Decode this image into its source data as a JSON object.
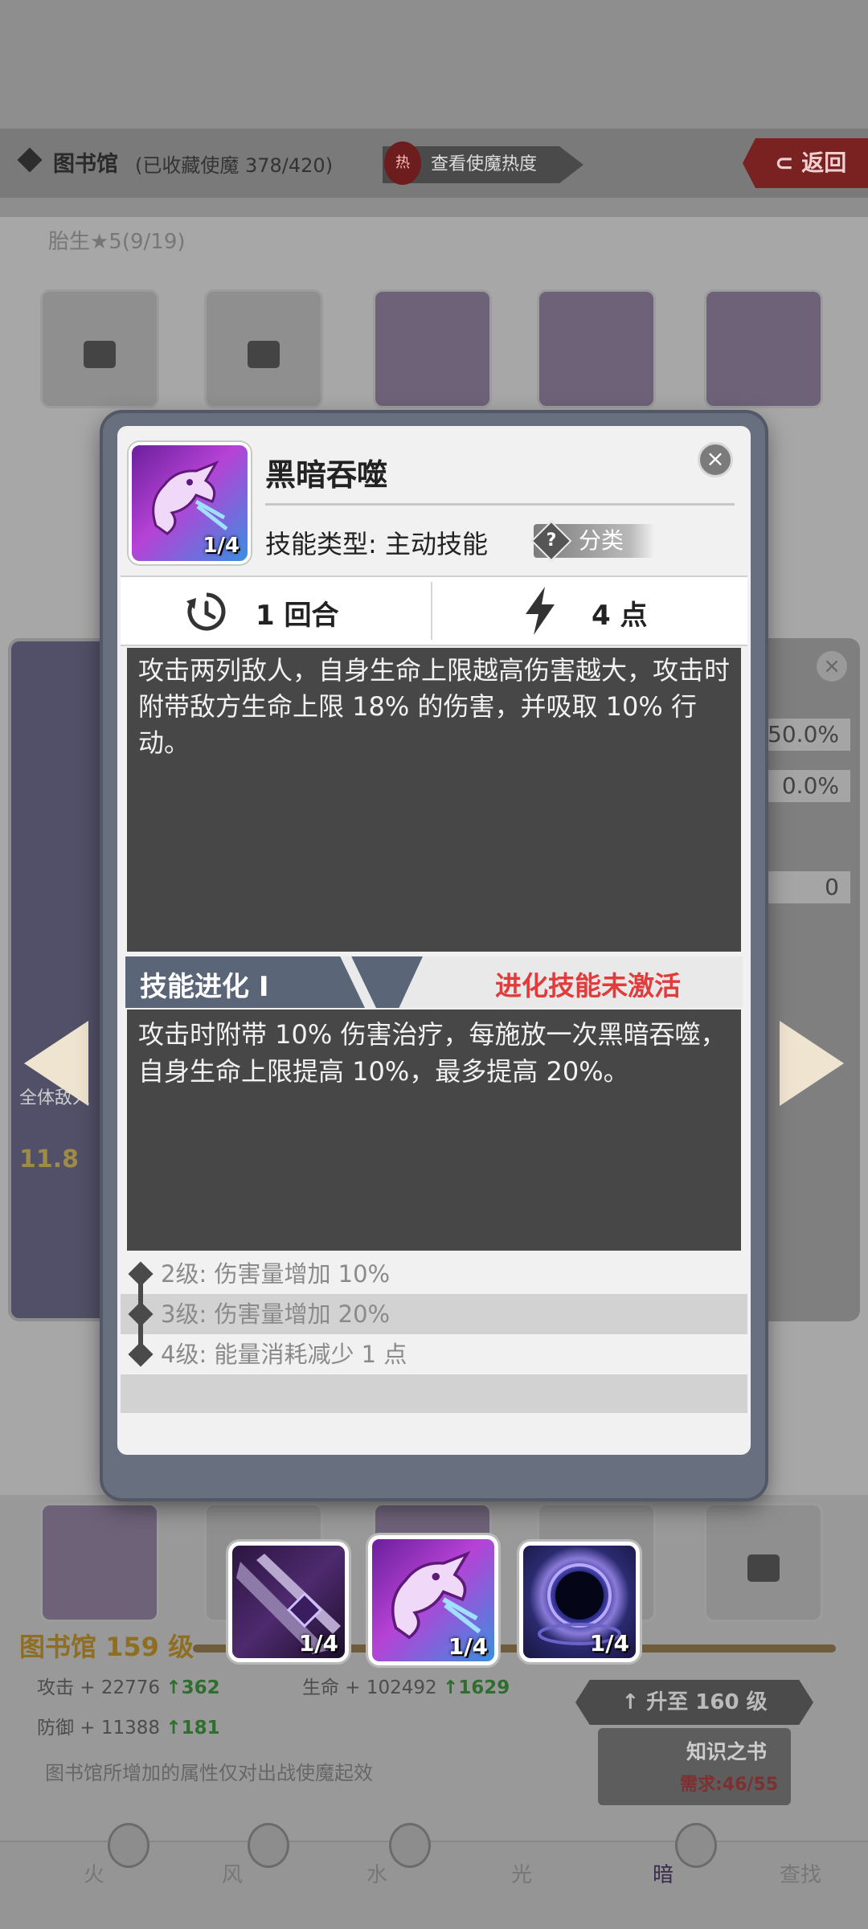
{
  "background": {
    "library_title": "图书馆",
    "library_count": "(已收藏使魔 378/420)",
    "hot_badge": "热",
    "hot_button": "查看使魔热度",
    "back_button": "返回",
    "section": "胎生★5(9/19)",
    "right_values": [
      "50.0%",
      "0.0%",
      "0"
    ],
    "left_label": "全体敌人",
    "left_value": "11.8",
    "library_level": "图书馆 159 级",
    "stats": {
      "attack_label": "攻击 + 22776",
      "attack_up": "362",
      "hp_label": "生命 + 102492",
      "hp_up": "1629",
      "defense_label": "防御 + 11388",
      "defense_up": "181"
    },
    "upgrade_button": "升至 160 级",
    "book_title": "知识之书",
    "book_need": "需求:46/55",
    "note": "图书馆所增加的属性仅对出战使魔起效",
    "tabs": [
      "火",
      "风",
      "水",
      "光",
      "暗",
      "查找"
    ],
    "active_tab": "暗"
  },
  "modal": {
    "skill_name": "黑暗吞噬",
    "icon_level": "1/4",
    "skill_type_label": "技能类型: 主动技能",
    "category_chip": "分类",
    "category_q": "?",
    "close_symbol": "×",
    "cooldown": "1 回合",
    "energy_cost": "4 点",
    "description": "攻击两列敌人，自身生命上限越高伤害越大，攻击时附带敌方生命上限 18% 的伤害，并吸取 10% 行动。",
    "evolution_title": "技能进化 Ⅰ",
    "evolution_status": "进化技能未激活",
    "evolution_text": "攻击时附带 10% 伤害治疗，每施放一次黑暗吞噬，自身生命上限提高 10%，最多提高 20%。",
    "upgrades": [
      "2级: 伤害量增加 10%",
      "3级: 伤害量增加 20%",
      "4级: 能量消耗减少 1 点"
    ]
  },
  "skill_selector": [
    {
      "level": "1/4",
      "icon": "shadow-blade-icon"
    },
    {
      "level": "1/4",
      "icon": "dark-dragon-icon",
      "selected": true
    },
    {
      "level": "1/4",
      "icon": "void-orb-icon"
    }
  ],
  "colors": {
    "accent_red": "#e23b3b",
    "evo_tag": "#5a6678",
    "desc_bg": "#474747"
  }
}
